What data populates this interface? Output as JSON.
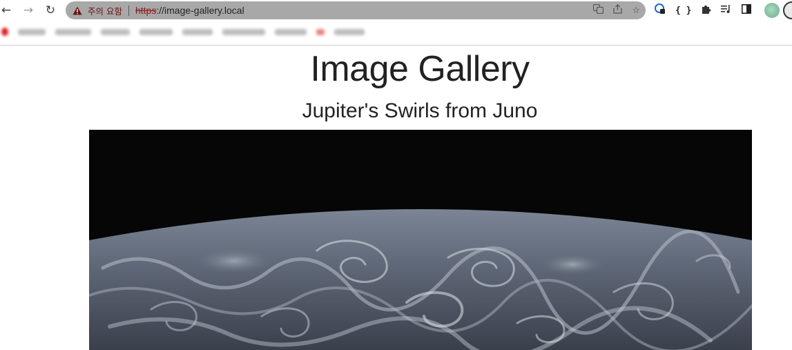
{
  "browser": {
    "security_warning": "주의 요함",
    "url_scheme": "https",
    "url_rest": "://image-gallery.local",
    "colors": {
      "omnibox": "#a8a8a8",
      "warning": "#6b1010"
    }
  },
  "toolbar_icons": [
    "back-arrow-icon",
    "forward-arrow-icon",
    "reload-icon",
    "translate-icon",
    "share-icon",
    "star-icon",
    "extension-icon",
    "code-braces-icon",
    "puzzle-icon",
    "media-queue-icon",
    "side-panel-icon"
  ],
  "page": {
    "title": "Image Gallery",
    "image_caption": "Jupiter's Swirls from Juno"
  }
}
